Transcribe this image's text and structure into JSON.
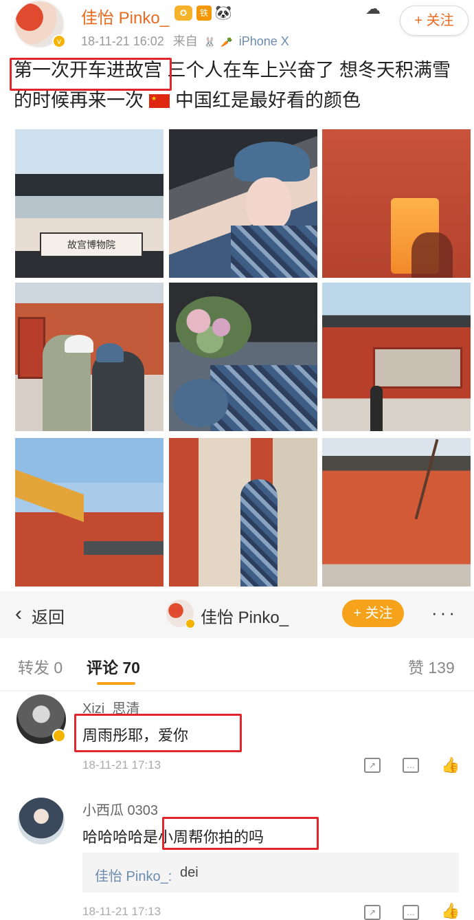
{
  "post": {
    "username": "佳怡 Pinko_",
    "badge_vip": "✪",
    "badge_fan": "铁",
    "badge_panda": "🐼",
    "timestamp": "18-11-21 16:02",
    "from_label": "来自",
    "device": "iPhone X",
    "follow_label": "+ 关注",
    "text_highlight": "第一次开车进故宫",
    "text_rest": " 三个人在车上兴奋了 想冬天积满雪的时候再来一次",
    "text_tail": "中国红是最好看的颜色",
    "photo1_sign": "故宫博物院"
  },
  "nav": {
    "back_label": "返回",
    "username": "佳怡 Pinko_",
    "follow_label": "+ 关注",
    "more": "···"
  },
  "tabs": {
    "repost": "转发 0",
    "comments": "评论 70",
    "likes": "赞 139"
  },
  "comments": [
    {
      "name": "Xizi_思清",
      "text": "周雨彤耶，爱你",
      "time": "18-11-21 17:13"
    },
    {
      "name": "小西瓜 0303",
      "text_prefix": "哈哈哈哈是",
      "text_highlight": "小周帮你拍的吗",
      "reply_name": "佳怡 Pinko_:",
      "reply_text": "dei",
      "time": "18-11-21 17:13"
    }
  ],
  "colors": {
    "accent": "#f6a21a",
    "username": "#e86b1f",
    "highlight_box": "#e0262c",
    "link": "#6b8bb0"
  }
}
